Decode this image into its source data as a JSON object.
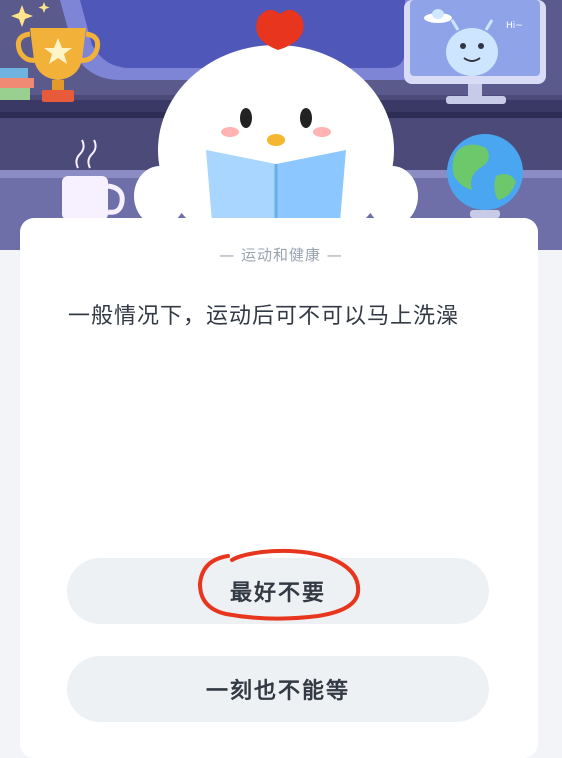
{
  "quiz": {
    "category": "运动和健康",
    "question": "一般情况下，运动后可不可以马上洗澡",
    "options": [
      {
        "label": "最好不要"
      },
      {
        "label": "一刻也不能等"
      }
    ]
  },
  "scene": {
    "sticker_text": "Hi~"
  },
  "annotation": {
    "mark_color": "#e8351e"
  }
}
